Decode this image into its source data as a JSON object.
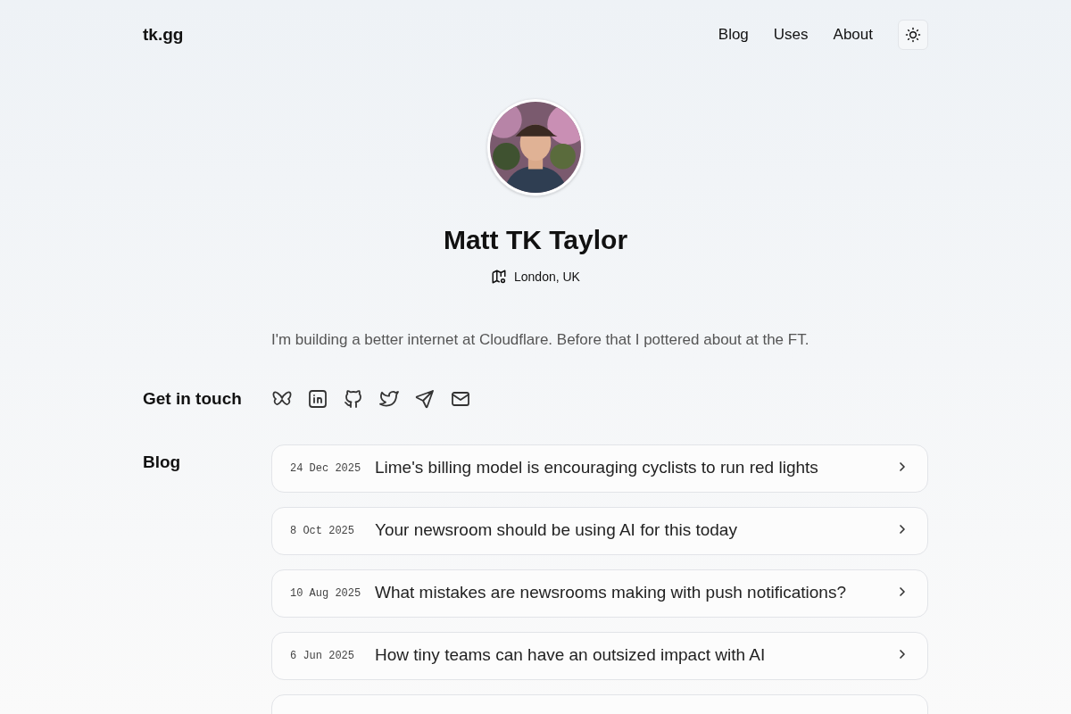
{
  "site_title": "tk.gg",
  "nav": [
    {
      "label": "Blog"
    },
    {
      "label": "Uses"
    },
    {
      "label": "About"
    }
  ],
  "profile": {
    "name": "Matt TK Taylor",
    "location": "London, UK",
    "bio": "I'm building a better internet at Cloudflare. Before that I pottered about at the FT."
  },
  "contact": {
    "heading": "Get in touch"
  },
  "blog": {
    "heading": "Blog",
    "posts": [
      {
        "date": "24 Dec 2025",
        "title": "Lime's billing model is encouraging cyclists to run red lights"
      },
      {
        "date": "8 Oct 2025",
        "title": "Your newsroom should be using AI for this today"
      },
      {
        "date": "10 Aug 2025",
        "title": "What mistakes are newsrooms making with push notifications?"
      },
      {
        "date": "6 Jun 2025",
        "title": "How tiny teams can have an outsized impact with AI"
      }
    ],
    "more_posts_cut_off": true
  }
}
